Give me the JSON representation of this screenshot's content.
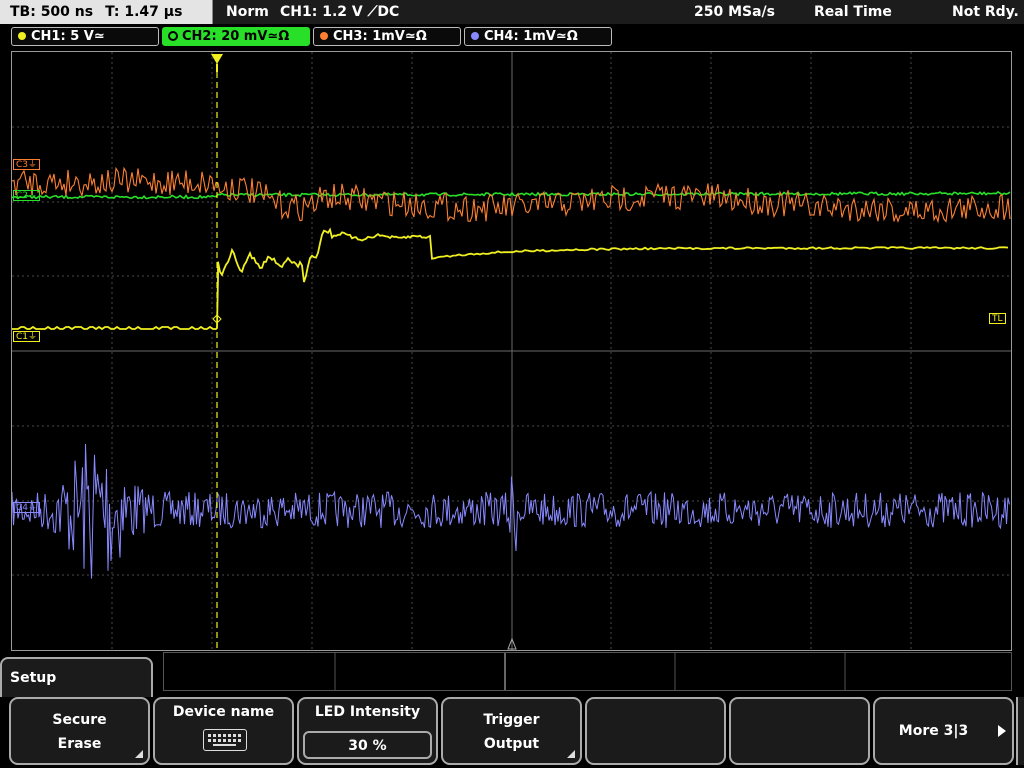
{
  "topbar": {
    "timebase": "TB: 500 ns",
    "trigger_time": "T: 1.47 µs",
    "mode": "Norm",
    "trigger_setting": "CH1: 1.2 V ⟋DC",
    "sample_rate": "250 MSa/s",
    "acq_mode": "Real Time",
    "status": "Not Rdy."
  },
  "channels": [
    {
      "label": "CH1: 5 V≃",
      "color": "#f0f020"
    },
    {
      "label": "CH2: 20 mV≃Ω",
      "color": "#28e028"
    },
    {
      "label": "CH3: 1mV≃Ω",
      "color": "#ff8030"
    },
    {
      "label": "CH4: 1mV≃Ω",
      "color": "#8888ff"
    }
  ],
  "markers": {
    "c3": "C3⏚",
    "c2": "C2⏚",
    "c1": "C1⏚",
    "c4": "C4⏚",
    "trigger_level": "TL"
  },
  "menu": {
    "tab": "Setup",
    "softkeys": [
      {
        "line1": "Secure",
        "line2": "Erase"
      },
      {
        "line1": "Device name",
        "icon": "keyboard-icon"
      },
      {
        "line1": "LED Intensity",
        "value": "30 %"
      },
      {
        "line1": "Trigger",
        "line2": "Output"
      },
      {
        "line1": ""
      },
      {
        "line1": ""
      },
      {
        "line1": "More 3|3"
      }
    ]
  },
  "colors": {
    "ch1": "#f0f020",
    "ch2": "#28e028",
    "ch3": "#ff8030",
    "ch4": "#8888ff",
    "grid": "#4a4a4a"
  }
}
